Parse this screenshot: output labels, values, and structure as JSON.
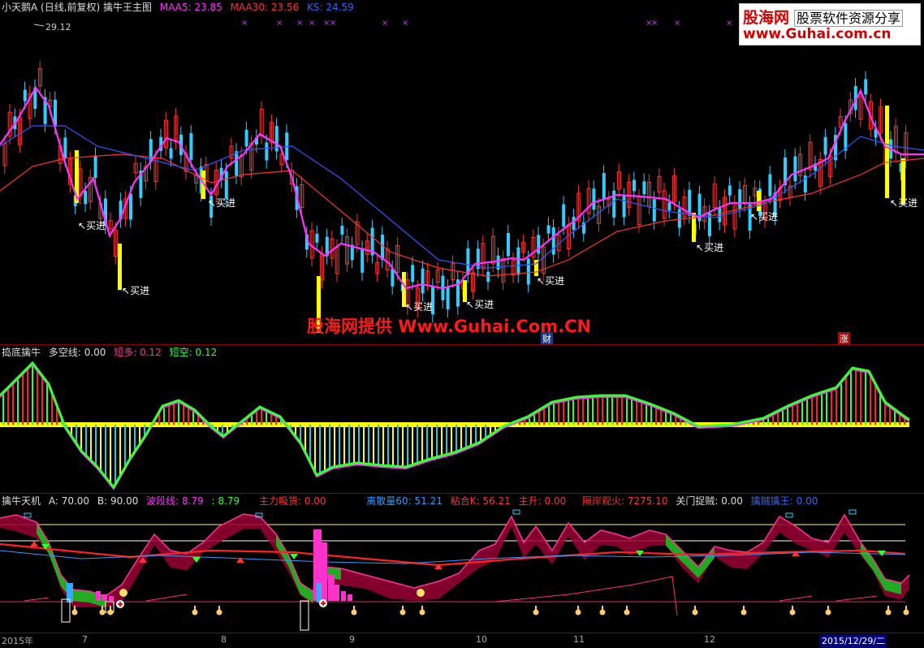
{
  "main": {
    "title": "小天鹅A (日线,前复权) 擒牛王主图",
    "maa5_label": "MAA5: 23.85",
    "maa30_label": "MAA30: 23.56",
    "ks_label": "KS: 24.59",
    "high_price": "29.12",
    "buy_label": "买进",
    "watermark": "股海网提供 Www.Guhai.Com.CN",
    "marker_cai": "财",
    "marker_zhang": "涨",
    "colors": {
      "maa5": "#ff33ff",
      "maa30": "#ff3333",
      "ks": "#3366ff"
    }
  },
  "logo": {
    "name": "股海网",
    "tagline": "股票软件资源分享",
    "url": "www.Guhai.com.cn"
  },
  "mid": {
    "title": "捣底擒牛",
    "duokong": "多空线: 0.00",
    "duanduo": "短多: 0.12",
    "duankong": "短空: 0.12"
  },
  "bot": {
    "title": "擒牛天机",
    "a": "A: 70.00",
    "b": "B: 90.00",
    "boduan": "波段线: 8.79",
    "v2": ": 8.79",
    "zhuli": "主力吸货: 0.00",
    "lisan": "离散量60: 51.21",
    "zhanhe": "粘合K: 56.21",
    "zhusheng": "主升: 0.00",
    "geanguan": "隔岸观火: 7275.10",
    "guanmen": "关门捉贼: 0.00",
    "qinzei": "擒贼擒王: 0.00"
  },
  "timeline": {
    "labels": [
      "2015年",
      "7",
      "8",
      "9",
      "10",
      "11",
      "12",
      "2015/12/29/二"
    ]
  }
}
